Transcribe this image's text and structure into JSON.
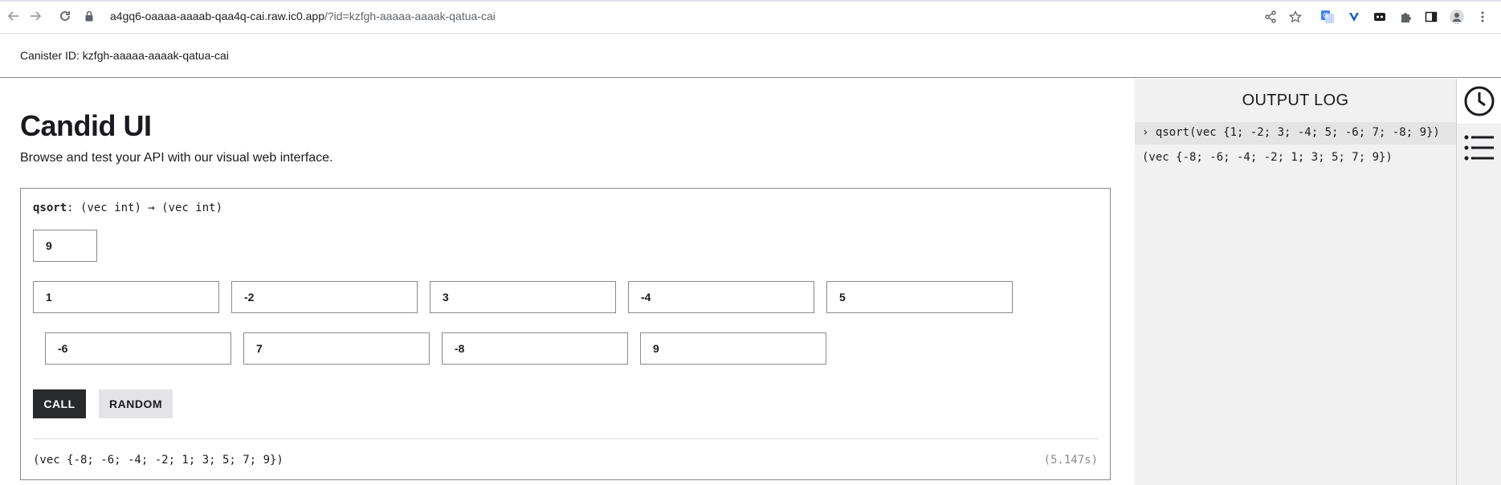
{
  "browser": {
    "url_host": "a4gq6-oaaaa-aaaab-qaa4q-cai.raw.ic0.app",
    "url_path": "/?id=kzfgh-aaaaa-aaaak-qatua-cai"
  },
  "header": {
    "canister_label": "Canister ID: kzfgh-aaaaa-aaaak-qatua-cai"
  },
  "main": {
    "title": "Candid UI",
    "subtitle": "Browse and test your API with our visual web interface."
  },
  "method": {
    "name": "qsort",
    "signature": ": (vec int) → (vec int)",
    "length_value": "9",
    "items": [
      "1",
      "-2",
      "3",
      "-4",
      "5",
      "-6",
      "7",
      "-8",
      "9"
    ],
    "call_label": "CALL",
    "random_label": "RANDOM",
    "result": "(vec {-8; -6; -4; -2; 1; 3; 5; 7; 9})",
    "timing": "(5.147s)"
  },
  "log": {
    "title": "OUTPUT LOG",
    "call_entry": "› qsort(vec {1; -2; 3; -4; 5; -6; 7; -8; 9})",
    "result_entry": "(vec {-8; -6; -4; -2; 1; 3; 5; 7; 9})"
  },
  "icons": {
    "rail": [
      "clock-icon",
      "list-icon"
    ],
    "toolbar": [
      "share-icon",
      "star-icon",
      "translate-icon",
      "extension-icon",
      "puzzle-icon",
      "sidepanel-icon",
      "profile-icon",
      "menu-icon"
    ]
  }
}
